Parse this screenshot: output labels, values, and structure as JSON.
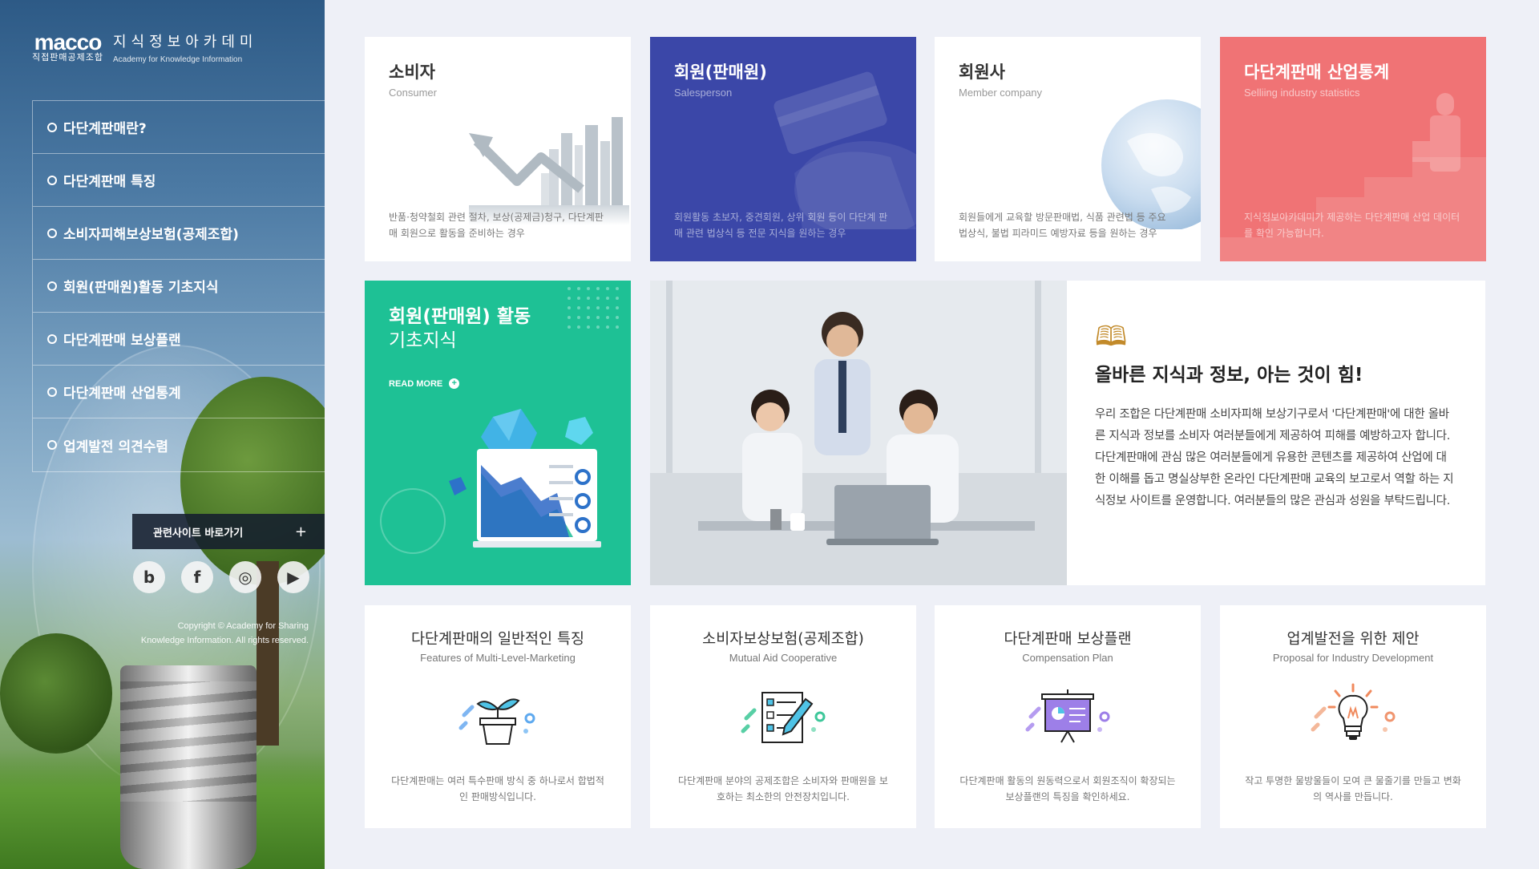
{
  "brand": {
    "logo_word": "macco",
    "logo_sub": "직접판매공제조합",
    "title_kr": "지식정보아카데미",
    "title_en": "Academy for Knowledge Information"
  },
  "nav": {
    "items": [
      {
        "label": "다단계판매란?"
      },
      {
        "label": "다단계판매 특징"
      },
      {
        "label": "소비자피해보상보험(공제조합)"
      },
      {
        "label": "회원(판매원)활동 기초지식"
      },
      {
        "label": "다단계판매 보상플랜"
      },
      {
        "label": "다단계판매 산업통계"
      },
      {
        "label": "업계발전 의견수렴"
      }
    ]
  },
  "related": {
    "label": "관련사이트 바로가기",
    "plus": "+"
  },
  "socials": [
    {
      "icon": "blog-icon",
      "glyph": "b"
    },
    {
      "icon": "facebook-icon",
      "glyph": "f"
    },
    {
      "icon": "instagram-icon",
      "glyph": "◎"
    },
    {
      "icon": "youtube-icon",
      "glyph": "▶"
    }
  ],
  "copyright": {
    "line1": "Copyright © Academy for Sharing",
    "line2": "Knowledge Information. All rights reserved."
  },
  "top_cards": [
    {
      "title": "소비자",
      "subtitle": "Consumer",
      "desc": "반품·청약철회 관련 절차, 보상(공제금)청구, 다단계판매 회원으로 활동을 준비하는 경우"
    },
    {
      "title": "회원(판매원)",
      "subtitle": "Salesperson",
      "desc": "회원활동 초보자, 중견회원, 상위 회원 등이 다단계 판매 관련 법상식 등 전문 지식을 원하는 경우"
    },
    {
      "title": "회원사",
      "subtitle": "Member company",
      "desc": "회원들에게 교육할 방문판매법, 식품 관련법 등 주요 법상식, 불법 피라미드 예방자료 등을 원하는 경우"
    },
    {
      "title": "다단계판매 산업통계",
      "subtitle": "Selliing industry statistics",
      "desc": "지식정보아카데미가 제공하는 다단계판매 산업 데이터를 확인 가능합니다."
    }
  ],
  "feature": {
    "title": "회원(판매원) 활동",
    "subtitle": "기초지식",
    "read_more": "READ MORE",
    "read_more_plus": "+"
  },
  "intro": {
    "icon": "open-book-icon",
    "title": "올바른 지식과 정보, 아는 것이 힘!",
    "text": "우리 조합은 다단계판매 소비자피해 보상기구로서 '다단계판매'에 대한 올바른 지식과 정보를 소비자 여러분들에게 제공하여 피해를 예방하고자 합니다. 다단계판매에 관심 많은 여러분들에게 유용한 콘텐츠를 제공하여 산업에 대한 이해를 돕고 명실상부한 온라인 다단계판매 교육의 보고로서 역할 하는 지식정보 사이트를 운영합니다. 여러분들의 많은 관심과 성원을 부탁드립니다."
  },
  "bottom_cards": [
    {
      "title": "다단계판매의 일반적인 특징",
      "subtitle": "Features of Multi-Level-Marketing",
      "icon": "plant-pot-icon",
      "desc": "다단계판매는 여러 특수판매 방식 중 하나로서 합법적인 판매방식입니다."
    },
    {
      "title": "소비자보상보험(공제조합)",
      "subtitle": "Mutual Aid Cooperative",
      "icon": "checklist-pen-icon",
      "desc": "다단계판매 분야의 공제조합은 소비자와 판매원을 보호하는 최소한의 안전장치입니다."
    },
    {
      "title": "다단계판매 보상플랜",
      "subtitle": "Compensation Plan",
      "icon": "presentation-board-icon",
      "desc": "다단계판매 활동의 원동력으로서 회원조직이 확장되는 보상플랜의 특징을 확인하세요."
    },
    {
      "title": "업계발전을 위한 제안",
      "subtitle": "Proposal for Industry Development",
      "icon": "lightbulb-icon",
      "desc": "작고 투명한 물방울들이 모여 큰 물줄기를 만들고 변화의 역사를 만듭니다."
    }
  ],
  "colors": {
    "salesperson": "#3b47a8",
    "statistics": "#f07375",
    "feature_green": "#1ec195",
    "background": "#eef0f7"
  }
}
